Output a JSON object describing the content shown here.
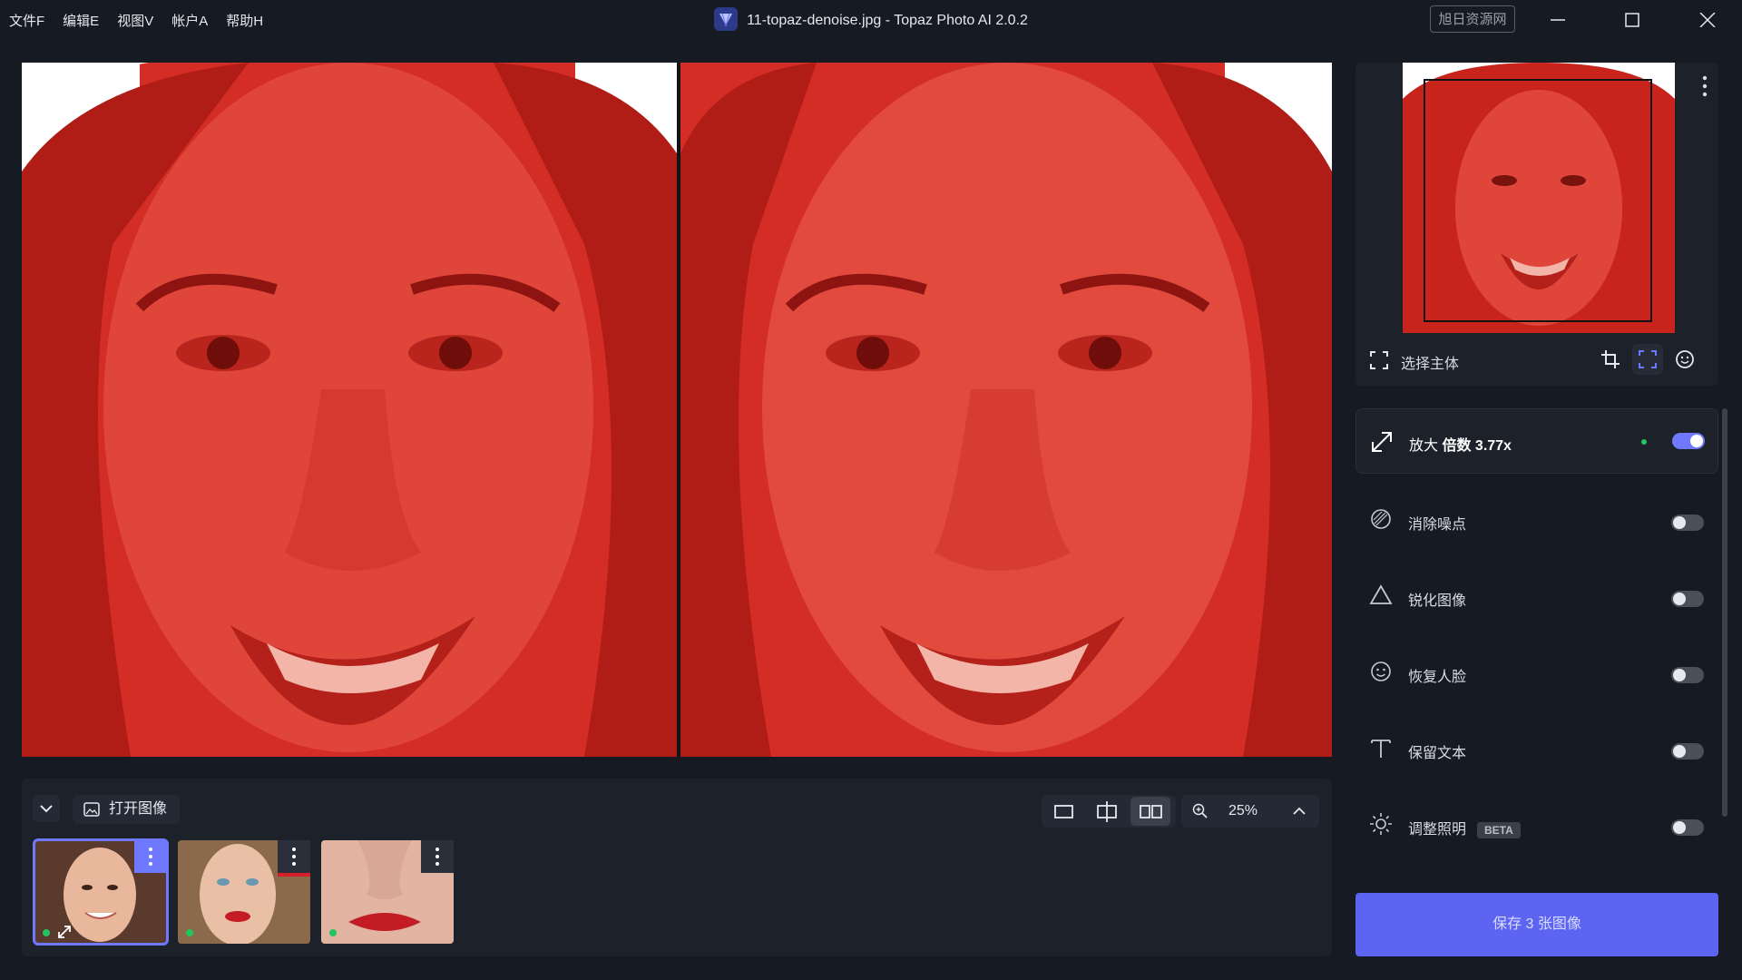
{
  "titlebar": {
    "menu": [
      "文件F",
      "编辑E",
      "视图V",
      "帐户A",
      "帮助H"
    ],
    "title": "11-topaz-denoise.jpg - Topaz Photo AI 2.0.2",
    "watermark": "旭日资源网"
  },
  "navigator": {
    "select_subject_label": "选择主体"
  },
  "tools": [
    {
      "icon": "upscale-icon",
      "label": "放大",
      "detail": "倍数 3.77x",
      "enabled": true
    },
    {
      "icon": "denoise-icon",
      "label": "消除噪点",
      "enabled": false
    },
    {
      "icon": "sharpen-icon",
      "label": "锐化图像",
      "enabled": false
    },
    {
      "icon": "face-icon",
      "label": "恢复人脸",
      "enabled": false
    },
    {
      "icon": "text-icon",
      "label": "保留文本",
      "enabled": false
    },
    {
      "icon": "sun-icon",
      "label": "调整照明",
      "badge": "BETA",
      "enabled": false
    }
  ],
  "bottombar": {
    "open_image_label": "打开图像",
    "zoom": "25%",
    "active_view_mode": "side-by-side"
  },
  "save_button": "保存 3 张图像",
  "colors": {
    "accent": "#6f79ff",
    "save_button": "#5d64f2",
    "status_green": "#22c55e",
    "overlay_red": "#d42c24"
  }
}
